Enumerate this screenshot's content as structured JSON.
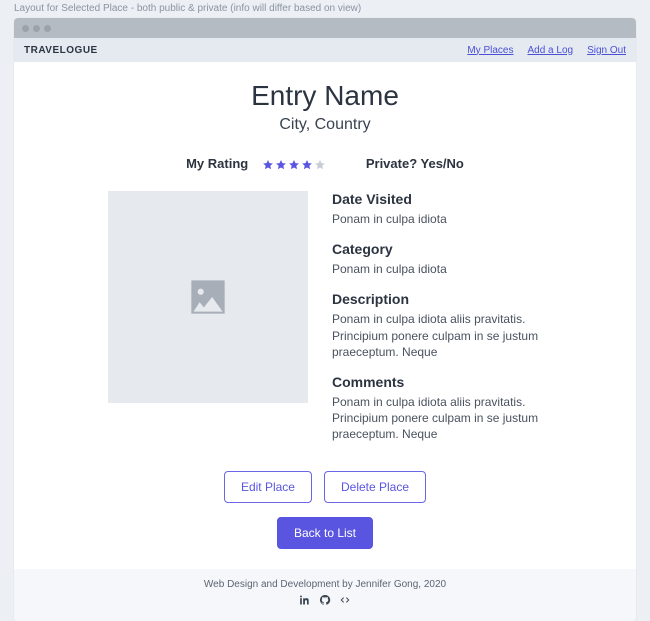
{
  "annotation": "Layout for Selected Place - both public & private (info will differ based on view)",
  "brand": "TRAVELOGUE",
  "nav": {
    "my_places": "My Places",
    "add_log": "Add a Log",
    "sign_out": "Sign Out"
  },
  "entry": {
    "title": "Entry Name",
    "location": "City, Country",
    "rating_label": "My Rating",
    "rating_value": 4,
    "rating_max": 5,
    "private_label": "Private? Yes/No",
    "date_visited_label": "Date Visited",
    "date_visited_value": "Ponam in culpa idiota",
    "category_label": "Category",
    "category_value": "Ponam in culpa idiota",
    "description_label": "Description",
    "description_value": "Ponam in culpa idiota aliis pravitatis. Principium ponere culpam in se justum praeceptum. Neque",
    "comments_label": "Comments",
    "comments_value": "Ponam in culpa idiota aliis pravitatis. Principium ponere culpam in se justum praeceptum. Neque"
  },
  "actions": {
    "edit": "Edit Place",
    "delete": "Delete Place",
    "back": "Back to List"
  },
  "footer": {
    "text": "Web Design and Development by Jennifer Gong, 2020"
  }
}
